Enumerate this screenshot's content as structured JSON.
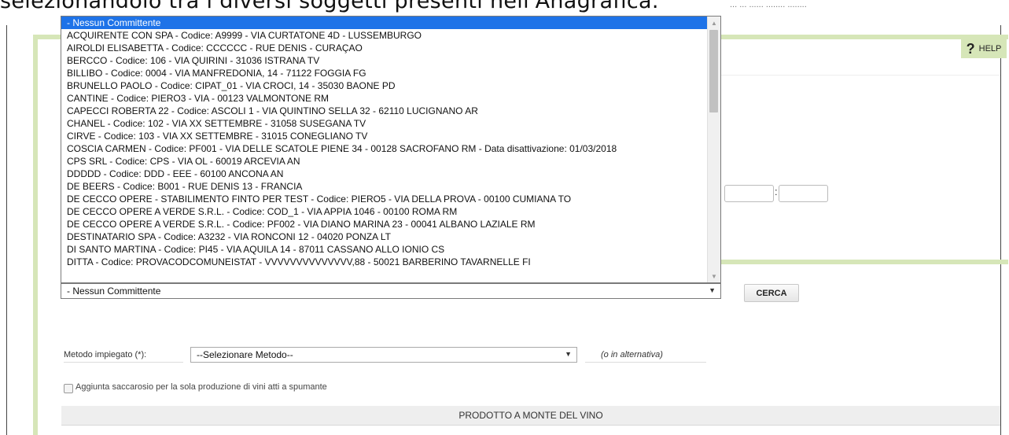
{
  "page": {
    "caption": "selezionandolo tra i diversi soggetti presenti nell'Anagrafica.",
    "top_right_text": "... ... ...... ........ ........"
  },
  "help": {
    "label": "HELP",
    "icon": "question-icon"
  },
  "committente": {
    "selected_value": "- Nessun Committente",
    "options": [
      "- Nessun Committente",
      "ACQUIRENTE CON SPA - Codice: A9999 - VIA CURTATONE 4D - LUSSEMBURGO",
      "AIROLDI ELISABETTA - Codice: CCCCCC - RUE DENIS - CURAÇAO",
      "BERCCO - Codice: 106 - VIA QUIRINI - 31036 ISTRANA TV",
      "BILLIBO - Codice: 0004 - VIA MANFREDONIA, 14 - 71122 FOGGIA FG",
      "BRUNELLO PAOLO - Codice: CIPAT_01 - VIA CROCI, 14 - 35030 BAONE PD",
      "CANTINE - Codice: PIERO3 - VIA - 00123 VALMONTONE RM",
      "CAPECCI ROBERTA 22 - Codice: ASCOLI 1 - VIA QUINTINO SELLA 32 - 62110 LUCIGNANO AR",
      "CHANEL - Codice: 102 - VIA XX SETTEMBRE - 31058 SUSEGANA TV",
      "CIRVE - Codice: 103 - VIA XX SETTEMBRE - 31015 CONEGLIANO TV",
      "COSCIA CARMEN - Codice: PF001 - VIA DELLE SCATOLE PIENE 34 - 00128 SACROFANO RM - Data disattivazione: 01/03/2018",
      "CPS SRL - Codice: CPS - VIA OL - 60019 ARCEVIA AN",
      "DDDDD - Codice: DDD - EEE - 60100 ANCONA AN",
      "DE BEERS - Codice: B001 - RUE DENIS 13 - FRANCIA",
      "DE CECCO OPERE - STABILIMENTO FINTO PER TEST - Codice: PIERO5 - VIA DELLA PROVA - 00100 CUMIANA TO",
      "DE CECCO OPERE A VERDE S.R.L. - Codice: COD_1 - VIA APPIA 1046 - 00100 ROMA RM",
      "DE CECCO OPERE A VERDE S.R.L. - Codice: PF002 - VIA DIANO MARINA 23 - 00041 ALBANO LAZIALE RM",
      "DESTINATARIO SPA - Codice: A3232 - VIA RONCONI 12 - 04020 PONZA LT",
      "DI SANTO MARTINA - Codice: PI45 - VIA AQUILA 14 - 87011 CASSANO ALLO IONIO CS",
      "DITTA - Codice: PROVACODCOMUNEISTAT - VVVVVVVVVVVVVV,88 - 50021 BARBERINO TAVARNELLE FI"
    ]
  },
  "search": {
    "button_label": "CERCA"
  },
  "metodo": {
    "label": "Metodo impiegato (*):",
    "selected_value": "--Selezionare Metodo--",
    "alternative_note": "(o in alternativa)"
  },
  "saccarosio": {
    "label": "Aggiunta saccarosio per la sola produzione di vini atti a spumante",
    "checked": false
  },
  "section": {
    "title": "PRODOTTO A MONTE DEL VINO"
  },
  "colors": {
    "selected_option": "#1e73e8",
    "panel_accent": "#d6e6b8"
  }
}
